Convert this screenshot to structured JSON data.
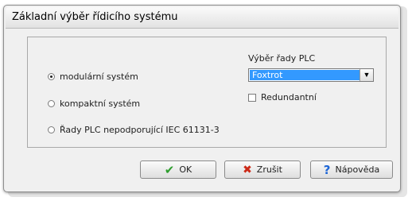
{
  "dialog": {
    "title": "Základní výběr řídicího systému"
  },
  "system_type": {
    "options": [
      {
        "label": "modulární systém",
        "selected": true
      },
      {
        "label": "kompaktní systém",
        "selected": false
      },
      {
        "label": "Řady PLC nepodporující IEC 61131-3",
        "selected": false
      }
    ]
  },
  "plc_series": {
    "label": "Výběr řady PLC",
    "selected_value": "Foxtrot",
    "redundant_label": "Redundantní",
    "redundant_checked": false
  },
  "buttons": {
    "ok_label": "OK",
    "cancel_label": "Zrušit",
    "help_label": "Nápověda"
  },
  "icons": {
    "ok": "checkmark-icon",
    "cancel": "x-icon",
    "help": "question-icon",
    "dropdown": "chevron-down-icon"
  },
  "colors": {
    "selection": "#3399ff",
    "ok_icon": "#2e9e2e",
    "cancel_icon": "#cc2a18",
    "help_icon": "#1e66d6"
  }
}
